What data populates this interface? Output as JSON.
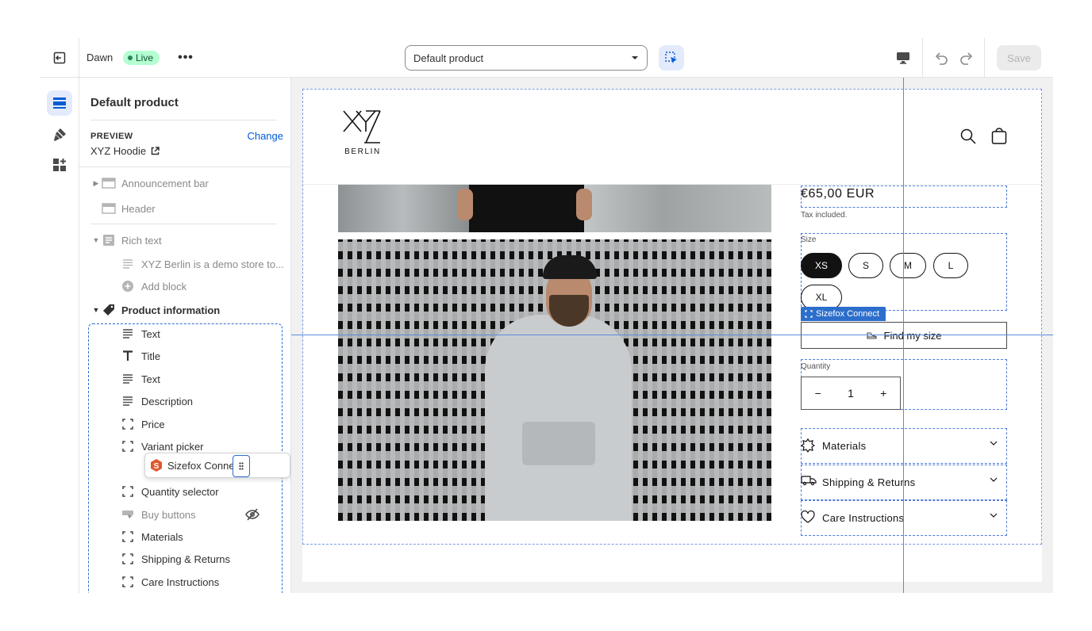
{
  "topbar": {
    "theme_name": "Dawn",
    "live_badge": "Live",
    "template_select": "Default product",
    "save_label": "Save"
  },
  "sidebar": {
    "title": "Default product",
    "preview_label": "PREVIEW",
    "change_link": "Change",
    "preview_product": "XYZ Hoodie",
    "sections": {
      "announcement_bar": "Announcement bar",
      "header": "Header",
      "rich_text": "Rich text",
      "rich_text_block": "XYZ Berlin is a demo store to...",
      "add_block": "Add block",
      "product_information": "Product information"
    },
    "blocks": [
      {
        "label": "Text",
        "icon": "text-icon"
      },
      {
        "label": "Title",
        "icon": "title-icon"
      },
      {
        "label": "Text",
        "icon": "text-icon"
      },
      {
        "label": "Description",
        "icon": "text-icon"
      },
      {
        "label": "Price",
        "icon": "app-block-icon"
      },
      {
        "label": "Variant picker",
        "icon": "app-block-icon"
      },
      {
        "label": "Quantity selector",
        "icon": "app-block-icon"
      },
      {
        "label": "Buy buttons",
        "icon": "buy-icon",
        "hidden": true
      },
      {
        "label": "Materials",
        "icon": "app-block-icon"
      },
      {
        "label": "Shipping & Returns",
        "icon": "app-block-icon"
      },
      {
        "label": "Care Instructions",
        "icon": "app-block-icon"
      }
    ],
    "dragging_block": "Sizefox Connect"
  },
  "storefront": {
    "logo_sub": "BERLIN",
    "price": "€65,00 EUR",
    "tax_note": "Tax included.",
    "size_label": "Size",
    "sizes": [
      "XS",
      "S",
      "M",
      "L",
      "XL"
    ],
    "selected_size": "XS",
    "sizefox_tag": "Sizefox Connect",
    "find_size_button": "Find my size",
    "quantity_label": "Quantity",
    "quantity_minus": "−",
    "quantity_value": "1",
    "quantity_plus": "+",
    "accordions": [
      {
        "label": "Materials",
        "icon": "fabric-icon"
      },
      {
        "label": "Shipping & Returns",
        "icon": "truck-icon"
      },
      {
        "label": "Care Instructions",
        "icon": "heart-icon"
      }
    ]
  },
  "colors": {
    "accent": "#2c6ecb",
    "live_badge_bg": "#b4fed2",
    "selected_size_bg": "#121212"
  }
}
